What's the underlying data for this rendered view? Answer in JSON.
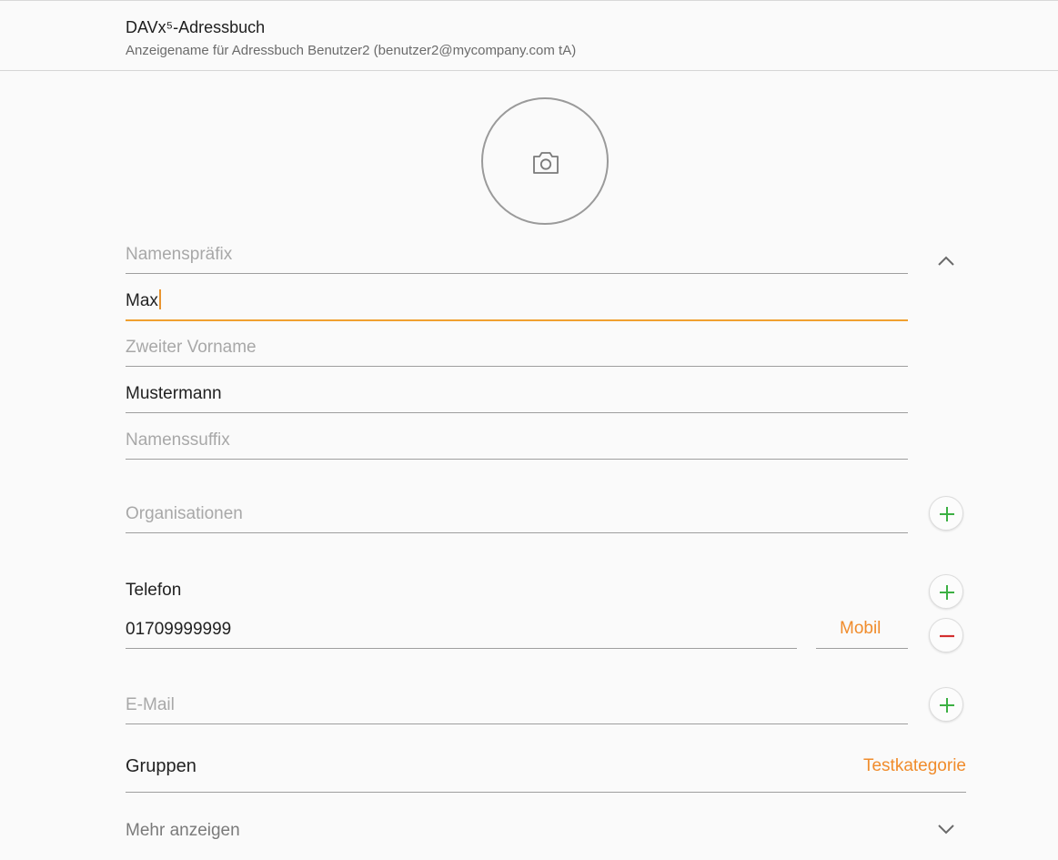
{
  "account": {
    "title": "DAVx⁵-Adressbuch",
    "subtitle": "Anzeigename für Adressbuch Benutzer2 (benutzer2@mycompany.com tA)"
  },
  "photo": {
    "icon": "camera-icon"
  },
  "name_fields": {
    "prefix_placeholder": "Namenspräfix",
    "first_name_value": "Max",
    "middle_name_placeholder": "Zweiter Vorname",
    "last_name_value": "Mustermann",
    "suffix_placeholder": "Namenssuffix"
  },
  "organizations": {
    "placeholder": "Organisationen"
  },
  "phone": {
    "section_label": "Telefon",
    "number": "01709999999",
    "type": "Mobil"
  },
  "email": {
    "placeholder": "E-Mail"
  },
  "groups": {
    "label": "Gruppen",
    "value": "Testkategorie"
  },
  "more": {
    "label": "Mehr anzeigen"
  },
  "colors": {
    "accent": "#f08c2c",
    "add": "#3cb043",
    "remove": "#d32f2f",
    "hint": "#a8a8a8"
  }
}
